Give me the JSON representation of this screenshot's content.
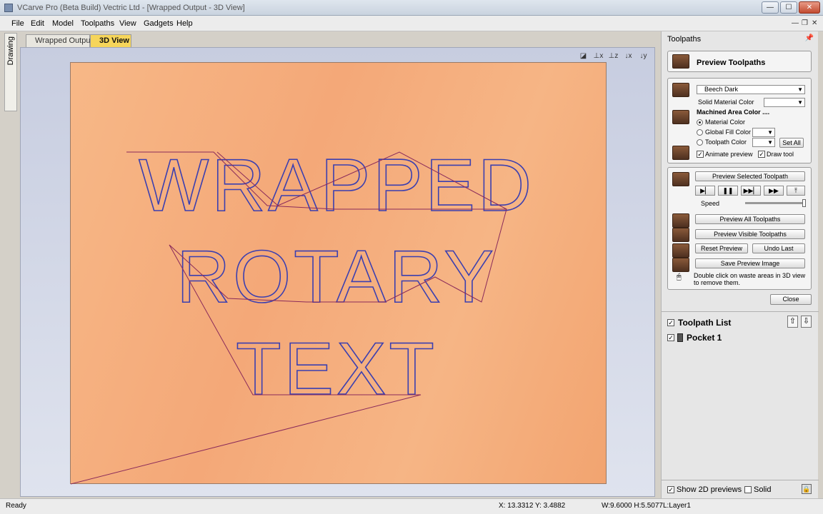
{
  "window": {
    "title": "VCarve Pro (Beta Build) Vectric Ltd - [Wrapped Output - 3D View]",
    "min": "—",
    "max": "☐",
    "close": "✕",
    "mdi_min": "—",
    "mdi_restore": "❐",
    "mdi_close": "✕"
  },
  "menu": [
    "File",
    "Edit",
    "Model",
    "Toolpaths",
    "View",
    "Gadgets",
    "Help"
  ],
  "left_tab": "Drawing",
  "tabs": [
    {
      "label": "Wrapped Output",
      "active": false
    },
    {
      "label": "3D View",
      "active": true
    }
  ],
  "canvas_text": [
    "WRAPPED",
    "ROTARY",
    "TEXT"
  ],
  "right_panel": {
    "header": "Toolpaths",
    "preview_title": "Preview Toolpaths",
    "material": {
      "combo_value": "Beech Dark",
      "solid_material_color_label": "Solid Material Color",
      "machined_area_label": "Machined Area Color ....",
      "options": [
        "Material Color",
        "Global Fill Color",
        "Toolpath Color"
      ],
      "selected_option": 0,
      "set_all": "Set All",
      "animate_preview": "Animate preview",
      "draw_tool": "Draw tool"
    },
    "preview": {
      "preview_selected": "Preview Selected Toolpath",
      "speed_label": "Speed",
      "speed_level": 1.0,
      "preview_all": "Preview All Toolpaths",
      "preview_visible": "Preview Visible Toolpaths",
      "reset_preview": "Reset Preview",
      "undo_last": "Undo Last",
      "save_image": "Save Preview Image",
      "hint": "Double click on waste areas in 3D view to remove them."
    },
    "close": "Close",
    "toolpath_list_label": "Toolpath List",
    "toolpaths": [
      "Pocket 1"
    ],
    "show_2d": "Show 2D previews",
    "solid": "Solid"
  },
  "status": {
    "ready": "Ready",
    "xy": "X: 13.3312 Y: 3.4882",
    "wh": "W:9.6000  H:5.5077",
    "layer": "L:Layer1"
  },
  "colors": {
    "board": "#f4a878",
    "toolpath": "#3b3fb0",
    "active_tab": "#f6d55a"
  }
}
